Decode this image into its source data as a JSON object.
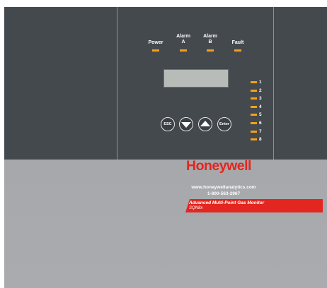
{
  "indicators": [
    {
      "label": "Power"
    },
    {
      "label": "Alarm\nA"
    },
    {
      "label": "Alarm\nB"
    },
    {
      "label": "Fault"
    }
  ],
  "channels": [
    "1",
    "2",
    "3",
    "4",
    "5",
    "6",
    "7",
    "8"
  ],
  "buttons": {
    "esc": "ESC",
    "enter": "Enter"
  },
  "brand": {
    "name": "Honeywell",
    "website": "www.honeywellanalytics.com",
    "phone": "1-800-563-2967",
    "product": "Advanced Multi-Point Gas Monitor",
    "model": "SQN8x"
  },
  "colors": {
    "panel_dark": "#44494e",
    "panel_light": "#a6a8ac",
    "led": "#f2a01e",
    "brand_red": "#e3261f"
  },
  "icons": {
    "down_button": "down-arrow-icon",
    "up_button": "up-arrow-icon"
  }
}
